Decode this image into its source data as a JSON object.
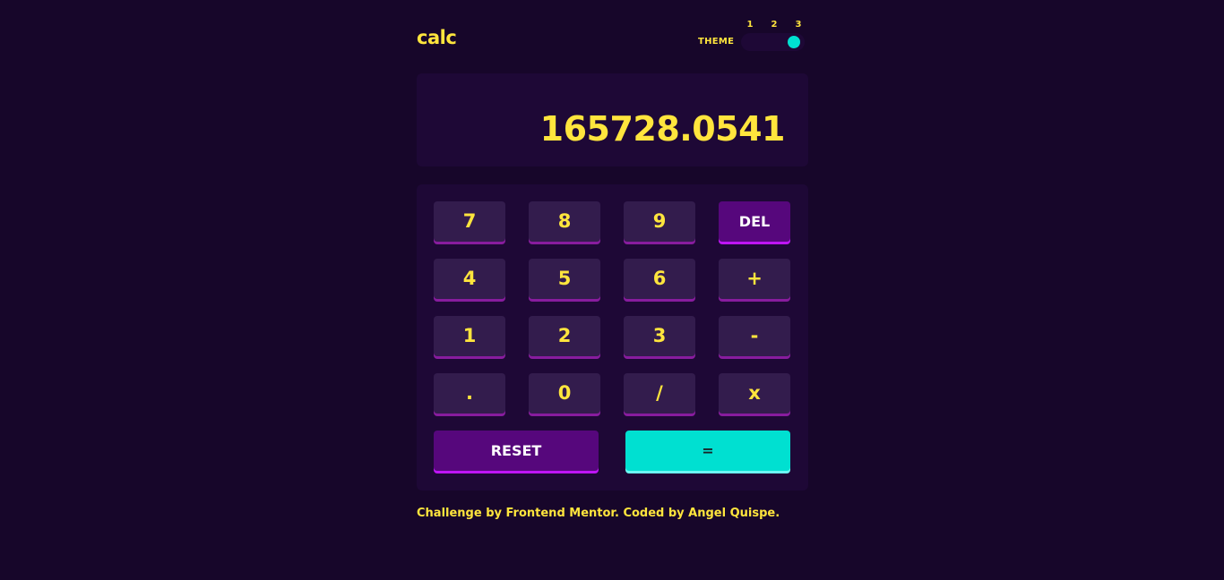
{
  "app": {
    "logo": "calc"
  },
  "theme": {
    "label": "THEME",
    "options": [
      "1",
      "2",
      "3"
    ],
    "selected": "3",
    "knob_color": "#00e0d1"
  },
  "display": {
    "value": "165728.0541"
  },
  "keys": {
    "k7": "7",
    "k8": "8",
    "k9": "9",
    "del": "DEL",
    "k4": "4",
    "k5": "5",
    "k6": "6",
    "plus": "+",
    "k1": "1",
    "k2": "2",
    "k3": "3",
    "minus": "-",
    "dot": ".",
    "k0": "0",
    "divide": "/",
    "multiply": "x",
    "reset": "RESET",
    "equals": "="
  },
  "colors": {
    "background": "#17062a",
    "panel": "#1e0836",
    "key": "#331c4d",
    "key_text": "#ffe53d",
    "function_key": "#56077c",
    "equals_key": "#00e0d1"
  },
  "footer": {
    "text": "Challenge by Frontend Mentor. Coded by Angel Quispe."
  }
}
